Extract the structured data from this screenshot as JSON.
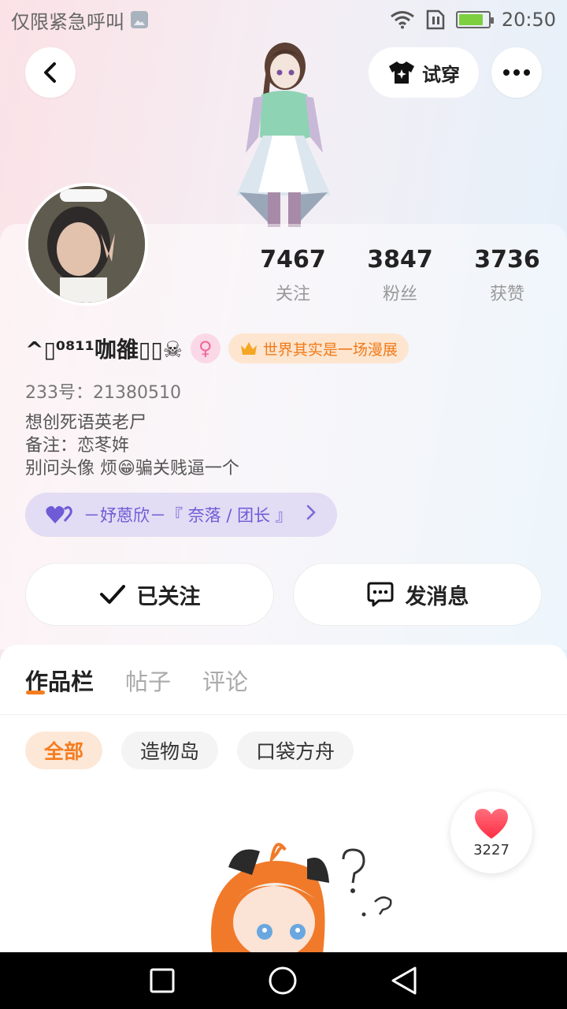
{
  "status_bar": {
    "emergency_text": "仅限紧急呼叫",
    "time": "20:50",
    "battery_level": 0.85
  },
  "header": {
    "tryon_label": "试穿"
  },
  "profile": {
    "stats": [
      {
        "value": "7467",
        "label": "关注"
      },
      {
        "value": "3847",
        "label": "粉丝"
      },
      {
        "value": "3736",
        "label": "获赞"
      }
    ],
    "name": "^▯⁰⁸¹¹咖雒▯▯☠",
    "gender_symbol": "♀",
    "title_badge": "世界其实是一场漫展",
    "uid": "233号：21380510",
    "bio_lines": [
      "想创死语英老尸",
      "备注：恋苳姩",
      "别问头像 烦😁骗关贱逼一个"
    ],
    "guild": "－妤蒽欣－『 奈落 / 团长 』",
    "follow_button": "已关注",
    "message_button": "发消息"
  },
  "content": {
    "tabs": [
      "作品栏",
      "帖子",
      "评论"
    ],
    "active_tab": 0,
    "chips": [
      "全部",
      "造物岛",
      "口袋方舟"
    ],
    "active_chip": 0,
    "like_count": "3227"
  },
  "colors": {
    "accent": "#f57c1f",
    "guild_purple": "#6f5bd6",
    "heart_red": "#ff4a5a"
  }
}
